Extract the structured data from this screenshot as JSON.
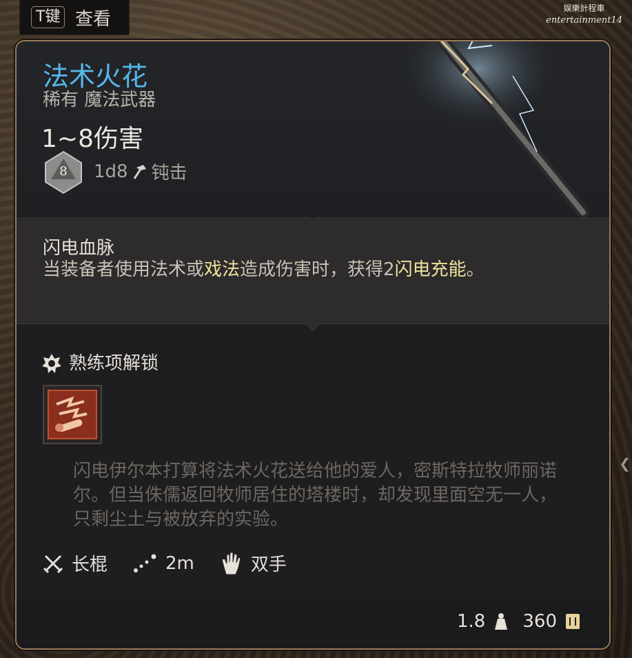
{
  "hint": {
    "key": "T键",
    "text": "查看"
  },
  "watermark": {
    "line1": "娱樂計程車",
    "line2": "entertainment14"
  },
  "item": {
    "name": "法术火花",
    "rarity_type": "稀有 魔法武器",
    "damage": "1~8伤害",
    "die_face": "8",
    "dice": "1d8",
    "damage_type": "钝击",
    "passive": {
      "name": "闪电血脉",
      "desc_a": "当装备者使用法术或",
      "desc_hl1": "戏法",
      "desc_b": "造成伤害时，获得2",
      "desc_hl2": "闪电充能",
      "desc_c": "。"
    },
    "proficiency_title": "熟练项解锁",
    "lore": "闪电伊尔本打算将法术火花送给他的爱人，密斯特拉牧师丽诺尔。但当侏儒返回牧师居住的塔楼时，却发现里面空无一人，只剩尘土与被放弃的实验。",
    "properties": {
      "weapon_type": "长棍",
      "range": "2m",
      "handedness": "双手"
    },
    "weight": "1.8",
    "price": "360"
  },
  "colors": {
    "title": "#56b8ea",
    "highlight": "#efe39e",
    "border": "#9a7a58"
  },
  "icons": [
    "die-d8-icon",
    "hammer-icon",
    "proficiency-badge-icon",
    "skill-icon",
    "crossed-swords-icon",
    "range-icon",
    "hand-icon",
    "weight-icon",
    "gold-icon",
    "chevron-right-icon"
  ]
}
